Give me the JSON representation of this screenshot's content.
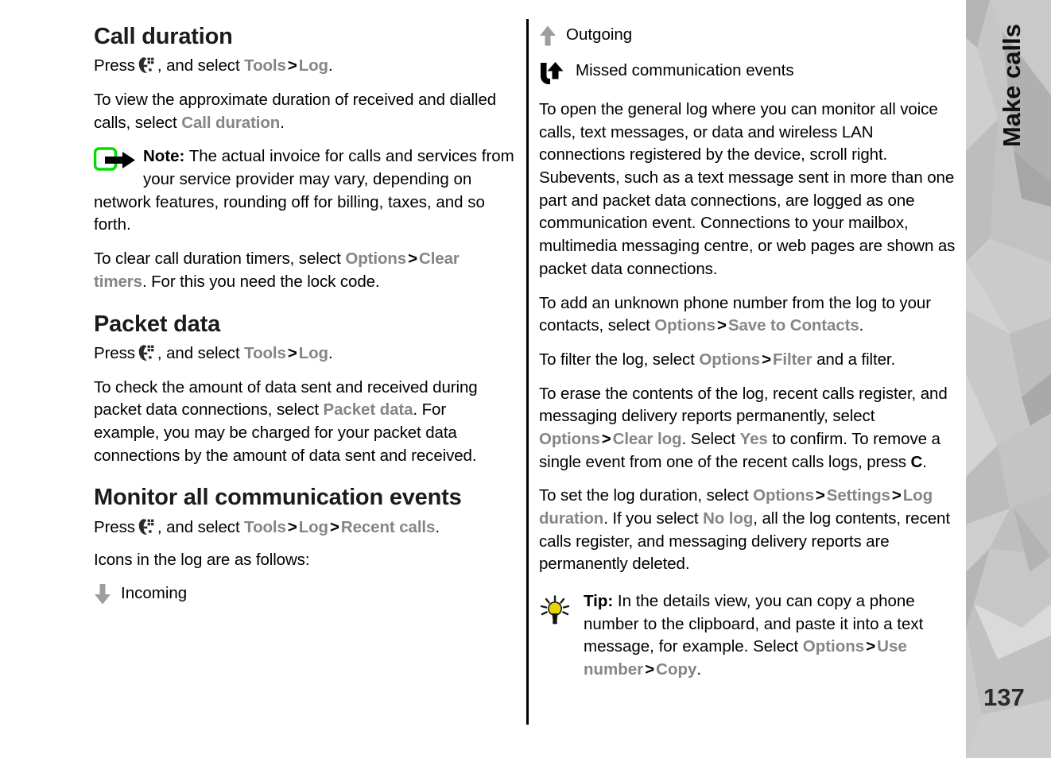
{
  "sidebar": {
    "chapter_title": "Make calls",
    "page_number": "137"
  },
  "left_column": {
    "section1": {
      "heading": "Call duration",
      "press_line": {
        "prefix": "Press",
        "icon": "menu-key-icon",
        "middle": ", and select",
        "ui1": "Tools",
        "sep": ">",
        "ui2": "Log",
        "suffix": "."
      },
      "para1_pre": "To view the approximate duration of received and dialled calls, select ",
      "para1_ui": "Call duration",
      "para1_post": ".",
      "note": {
        "icon": "note-arrow-icon",
        "label": "Note:",
        "text": " The actual invoice for calls and services from your service provider may vary, depending on network features, rounding off for billing, taxes, and so forth."
      },
      "para2_pre": "To clear call duration timers, select ",
      "para2_ui1": "Options",
      "para2_sep": ">",
      "para2_ui2": "Clear timers",
      "para2_post": ". For this you need the lock code."
    },
    "section2": {
      "heading": "Packet data",
      "press_line": {
        "prefix": "Press",
        "icon": "menu-key-icon",
        "middle": ", and select",
        "ui1": "Tools",
        "sep": ">",
        "ui2": "Log",
        "suffix": "."
      },
      "para1_pre": "To check the amount of data sent and received during packet data connections, select ",
      "para1_ui": "Packet data",
      "para1_post": ". For example, you may be charged for your packet data connections by the amount of data sent and received."
    },
    "section3": {
      "heading": "Monitor all communication events",
      "press_line": {
        "prefix": "Press",
        "icon": "menu-key-icon",
        "middle": ", and select",
        "ui1": "Tools",
        "sep1": ">",
        "ui2": "Log",
        "sep2": ">",
        "ui3": "Recent calls",
        "suffix": "."
      },
      "icons_intro": "Icons in the log are as follows:",
      "icon_items": [
        {
          "icon": "arrow-down-icon",
          "label": "Incoming"
        }
      ]
    }
  },
  "right_column": {
    "icon_items": [
      {
        "icon": "arrow-up-icon",
        "label": "Outgoing"
      },
      {
        "icon": "missed-call-uturn-icon",
        "label": "Missed communication events"
      }
    ],
    "para1": "To open the general log where you can monitor all voice calls, text messages, or data and wireless LAN connections registered by the device, scroll right. Subevents, such as a text message sent in more than one part and packet data connections, are logged as one communication event. Connections to your mailbox, multimedia messaging centre, or web pages are shown as packet data connections.",
    "para2_pre": "To add an unknown phone number from the log to your contacts, select ",
    "para2_ui1": "Options",
    "para2_sep": ">",
    "para2_ui2": "Save to Contacts",
    "para2_post": ".",
    "para3_pre": "To filter the log, select ",
    "para3_ui1": "Options",
    "para3_sep": ">",
    "para3_ui2": "Filter",
    "para3_post": " and a filter.",
    "para4_pre": "To erase the contents of the log, recent calls register, and messaging delivery reports permanently, select ",
    "para4_ui1": "Options",
    "para4_sep": ">",
    "para4_ui2": "Clear log",
    "para4_mid": ". Select ",
    "para4_ui3": "Yes",
    "para4_post": " to confirm. To remove a single event from one of the recent calls logs, press ",
    "para4_key": "C",
    "para4_end": ".",
    "para5_pre": "To set the log duration, select ",
    "para5_ui1": "Options",
    "para5_sep1": ">",
    "para5_ui2": "Settings",
    "para5_sep2": ">",
    "para5_ui3": "Log duration",
    "para5_mid": ". If you select ",
    "para5_ui4": "No log",
    "para5_post": ", all the log contents, recent calls register, and messaging delivery reports are permanently deleted.",
    "tip": {
      "icon": "lightbulb-tip-icon",
      "label": "Tip:",
      "text_pre": " In the details view, you can copy a phone number to the clipboard, and paste it into a text message, for example. Select ",
      "ui1": "Options",
      "sep1": ">",
      "ui2": "Use number",
      "sep2": ">",
      "ui3": "Copy",
      "post": "."
    }
  },
  "colors": {
    "ui_reference_gray": "#858585",
    "note_green": "#00dd00",
    "tip_yellow": "#e8d400",
    "sidebar_gray": "#c3c3c3",
    "body_black": "#000000"
  }
}
